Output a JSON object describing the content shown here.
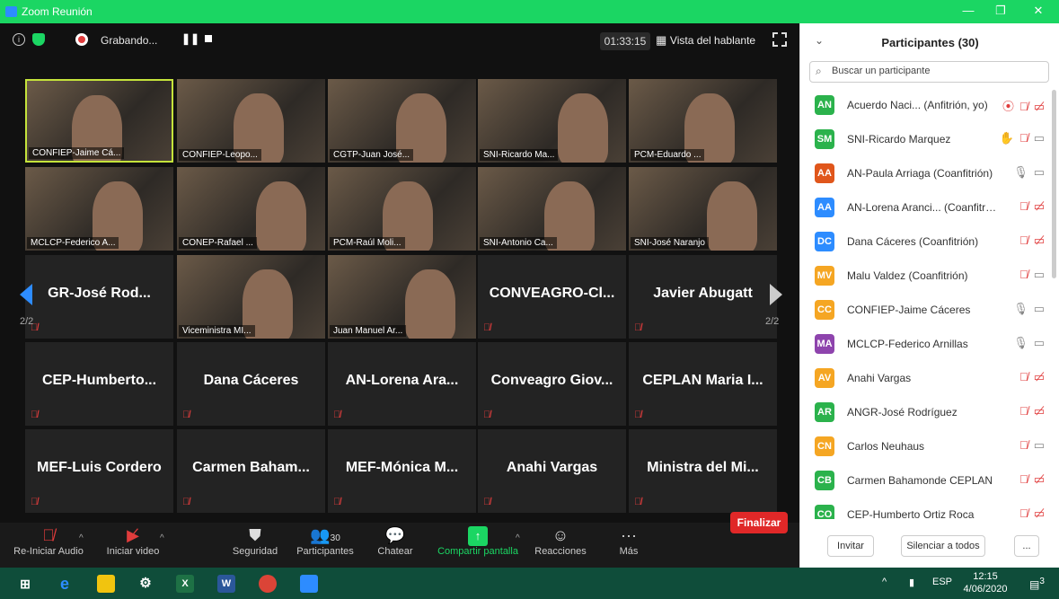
{
  "window": {
    "title": "Zoom Reunión"
  },
  "topbar": {
    "recording_label": "Grabando...",
    "timer": "01:33:15",
    "view_label": "Vista del hablante"
  },
  "video_tiles": [
    {
      "name": "CONFIEP-Jaime Cá...",
      "type": "video",
      "speaker": true
    },
    {
      "name": "CONFIEP-Leopo...",
      "type": "video"
    },
    {
      "name": "CGTP-Juan José...",
      "type": "video"
    },
    {
      "name": "SNI-Ricardo Ma...",
      "type": "video"
    },
    {
      "name": "PCM-Eduardo ...",
      "type": "video"
    },
    {
      "name": "MCLCP-Federico A...",
      "type": "video"
    },
    {
      "name": "CONEP-Rafael ...",
      "type": "video"
    },
    {
      "name": "PCM-Raúl Moli...",
      "type": "video"
    },
    {
      "name": "SNI-Antonio Ca...",
      "type": "video"
    },
    {
      "name": "SNI-José Naranjo",
      "type": "video"
    },
    {
      "name": "GR-José Rod...",
      "type": "name"
    },
    {
      "name": "Viceministra MI...",
      "type": "video"
    },
    {
      "name": "Juan Manuel Ar...",
      "type": "video"
    },
    {
      "name": "CONVEAGRO-Cl...",
      "type": "name"
    },
    {
      "name": "Javier Abugatt",
      "type": "name"
    },
    {
      "name": "CEP-Humberto...",
      "type": "name"
    },
    {
      "name": "Dana Cáceres",
      "type": "name"
    },
    {
      "name": "AN-Lorena Ara...",
      "type": "name"
    },
    {
      "name": "Conveagro Giov...",
      "type": "name"
    },
    {
      "name": "CEPLAN Maria I...",
      "type": "name"
    },
    {
      "name": "MEF-Luis Cordero",
      "type": "name"
    },
    {
      "name": "Carmen Baham...",
      "type": "name"
    },
    {
      "name": "MEF-Mónica M...",
      "type": "name"
    },
    {
      "name": "Anahi Vargas",
      "type": "name"
    },
    {
      "name": "Ministra del Mi...",
      "type": "name"
    }
  ],
  "pagination": {
    "left": "2/2",
    "right": "2/2"
  },
  "toolbar": {
    "audio_label": "Re-Iniciar Audio",
    "video_label": "Iniciar video",
    "security_label": "Seguridad",
    "participants_label": "Participantes",
    "participants_count": "30",
    "chat_label": "Chatear",
    "share_label": "Compartir pantalla",
    "reactions_label": "Reacciones",
    "more_label": "Más",
    "end_label": "Finalizar"
  },
  "panel": {
    "title": "Participantes (30)",
    "search_placeholder": "Buscar un participante",
    "invite_label": "Invitar",
    "mute_all_label": "Silenciar a todos",
    "more_label": "...",
    "participants": [
      {
        "initials": "AN",
        "color": "#2bb24c",
        "name": "Acuerdo Naci... (Anfitrión, yo)",
        "icons": "rec mute novid"
      },
      {
        "initials": "SM",
        "color": "#2bb24c",
        "name": "SNI-Ricardo Marquez",
        "icons": "hand mute vid"
      },
      {
        "initials": "AA",
        "color": "#e0561b",
        "name": "AN-Paula Arriaga (Coanfitrión)",
        "icons": "mic vid"
      },
      {
        "initials": "AA",
        "color": "#2d8cff",
        "name": "AN-Lorena Aranci... (Coanfitrión)",
        "icons": "mute novid"
      },
      {
        "initials": "DC",
        "color": "#2d8cff",
        "name": "Dana Cáceres (Coanfitrión)",
        "icons": "mute novid"
      },
      {
        "initials": "MV",
        "color": "#f5a623",
        "name": "Malu Valdez (Coanfitrión)",
        "icons": "mute vid"
      },
      {
        "initials": "CC",
        "color": "#f5a623",
        "name": "CONFIEP-Jaime Cáceres",
        "icons": "micon vid"
      },
      {
        "initials": "MA",
        "color": "#8e44ad",
        "name": "MCLCP-Federico Arnillas",
        "icons": "mic vid"
      },
      {
        "initials": "AV",
        "color": "#f5a623",
        "name": "Anahi Vargas",
        "icons": "mute novid"
      },
      {
        "initials": "AR",
        "color": "#2bb24c",
        "name": "ANGR-José Rodríguez",
        "icons": "mute novid"
      },
      {
        "initials": "CN",
        "color": "#f5a623",
        "name": "Carlos Neuhaus",
        "icons": "mute vid"
      },
      {
        "initials": "CB",
        "color": "#2bb24c",
        "name": "Carmen Bahamonde CEPLAN",
        "icons": "mute novid"
      },
      {
        "initials": "CO",
        "color": "#2bb24c",
        "name": "CEP-Humberto Ortiz Roca",
        "icons": "mute novid"
      }
    ]
  },
  "taskbar": {
    "lang": "ESP",
    "time": "12:15",
    "date": "4/06/2020",
    "notifications": "3"
  }
}
